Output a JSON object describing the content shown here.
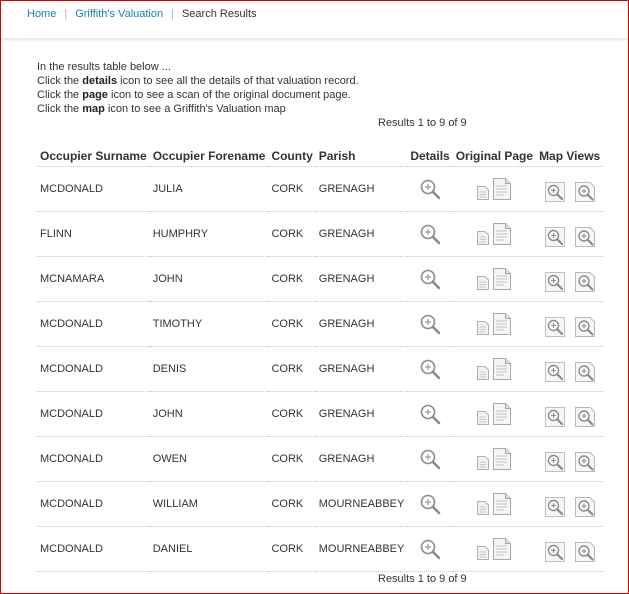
{
  "breadcrumb": {
    "home": "Home",
    "griffiths": "Griffith's Valuation",
    "current": "Search Results"
  },
  "instructions": {
    "line1": "In the results table below ...",
    "line2_pre": "Click the ",
    "line2_bold": "details",
    "line2_post": " icon to see all the details of that valuation record.",
    "line3_pre": "Click the ",
    "line3_bold": "page",
    "line3_post": " icon to see a scan of the original document page.",
    "line4_pre": "Click the ",
    "line4_bold": "map",
    "line4_post": " icon to see a Griffith's Valuation map"
  },
  "results_count": "Results 1 to 9 of 9",
  "table": {
    "headers": {
      "surname": "Occupier Surname",
      "forename": "Occupier Forename",
      "county": "County",
      "parish": "Parish",
      "details": "Details",
      "original_page": "Original Page",
      "map_views": "Map Views"
    },
    "rows": [
      {
        "surname": "MCDONALD",
        "forename": "JULIA",
        "county": "CORK",
        "parish": "GRENAGH"
      },
      {
        "surname": "FLINN",
        "forename": "HUMPHRY",
        "county": "CORK",
        "parish": "GRENAGH"
      },
      {
        "surname": "MCNAMARA",
        "forename": "JOHN",
        "county": "CORK",
        "parish": "GRENAGH"
      },
      {
        "surname": "MCDONALD",
        "forename": "TIMOTHY",
        "county": "CORK",
        "parish": "GRENAGH"
      },
      {
        "surname": "MCDONALD",
        "forename": "DENIS",
        "county": "CORK",
        "parish": "GRENAGH"
      },
      {
        "surname": "MCDONALD",
        "forename": "JOHN",
        "county": "CORK",
        "parish": "GRENAGH"
      },
      {
        "surname": "MCDONALD",
        "forename": "OWEN",
        "county": "CORK",
        "parish": "GRENAGH"
      },
      {
        "surname": "MCDONALD",
        "forename": "WILLIAM",
        "county": "CORK",
        "parish": "MOURNEABBEY"
      },
      {
        "surname": "MCDONALD",
        "forename": "DANIEL",
        "county": "CORK",
        "parish": "MOURNEABBEY"
      }
    ]
  },
  "icons": {
    "details": "magnifier-icon",
    "page_small": "page-thumbnail-icon",
    "page_big": "page-icon",
    "map_zoom_in": "map-zoom-in-icon",
    "map_zoom_page": "map-zoom-page-icon"
  },
  "colors": {
    "link": "#1a7fb5",
    "frame_border": "#d90000",
    "text": "#333333"
  }
}
